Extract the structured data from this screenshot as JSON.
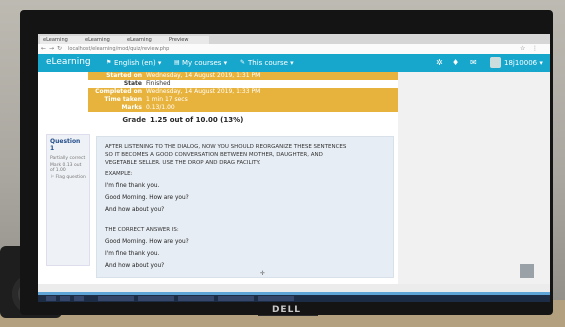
{
  "browser": {
    "tabs": [
      "eLearning",
      "eLearning",
      "eLearning",
      "Preview"
    ],
    "url": "localhost/elearning/mod/quiz/review.php"
  },
  "navbar": {
    "logo": "eLearning",
    "lang": "English (en) ▾",
    "courses": "My courses ▾",
    "this_course": "This course ▾",
    "user": "18j10006 ▾"
  },
  "summary": {
    "rows": [
      {
        "label": "Started on",
        "value": "Wednesday, 14 August 2019, 1:31 PM"
      },
      {
        "label": "State",
        "value": "Finished"
      },
      {
        "label": "Completed on",
        "value": "Wednesday, 14 August 2019, 1:33 PM"
      },
      {
        "label": "Time taken",
        "value": "1 min 17 secs"
      },
      {
        "label": "Marks",
        "value": "0.13/1.00"
      }
    ],
    "grade_label": "Grade",
    "grade_value": "1.25 out of 10.00 (13%)"
  },
  "question_info": {
    "heading": "Question 1",
    "status": "Partially correct",
    "mark": "Mark 0.13 out of 1.00",
    "flag": "Flag question"
  },
  "question": {
    "instructions": "AFTER LISTENING TO THE DIALOG, NOW YOU SHOULD REORGANIZE THESE SENTENCES SO IT BECOMES A GOOD CONVERSATION BETWEEN MOTHER, DAUGHTER, AND VEGETABLE SELLER. USE THE DROP AND DRAG FACILITY.",
    "example_title": "EXAMPLE:",
    "example_lines": [
      "I'm fine thank you.",
      "Good Morning. How are you?",
      "And how about you?"
    ],
    "answer_title": "THE CORRECT ANSWER IS:",
    "answer_lines": [
      "Good Morning. How are you?",
      "I'm fine thank you.",
      "And how about you?"
    ]
  },
  "monitor": {
    "brand": "DELL"
  }
}
